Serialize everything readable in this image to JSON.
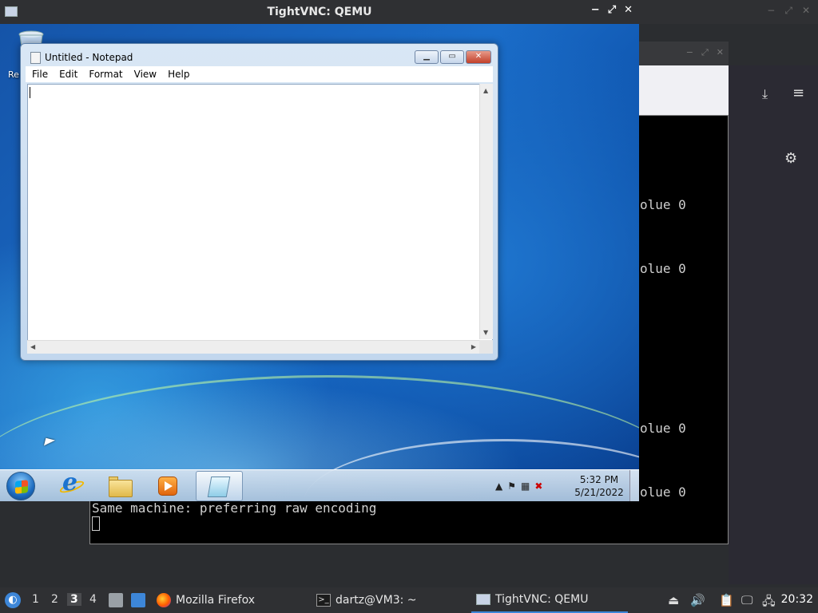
{
  "vnc": {
    "title": "TightVNC: QEMU",
    "minimize": "−",
    "maximize": "⤢",
    "close": "✕"
  },
  "desktop": {
    "recycle_bin_label": "Re"
  },
  "notepad": {
    "title": "Untitled - Notepad",
    "menus": [
      "File",
      "Edit",
      "Format",
      "View",
      "Help"
    ],
    "content": ""
  },
  "win7_taskbar": {
    "clock_time": "5:32 PM",
    "clock_date": "5/21/2022"
  },
  "terminal": {
    "partial_lines": [
      "olue 0",
      "olue 0",
      "olue 0",
      "olue 0"
    ],
    "last_line": "Same machine: preferring raw encoding"
  },
  "host_taskbar": {
    "desktops": [
      "1",
      "2",
      "3",
      "4"
    ],
    "active_desktop": "3",
    "tasks": {
      "firefox": "Mozilla Firefox",
      "terminal": "dartz@VM3: ~",
      "vnc": "TightVNC: QEMU"
    },
    "clock": "20:32"
  },
  "colors": {
    "accent": "#3d86d8",
    "terminal_bg": "#000000",
    "host_panel": "#2f3033"
  }
}
